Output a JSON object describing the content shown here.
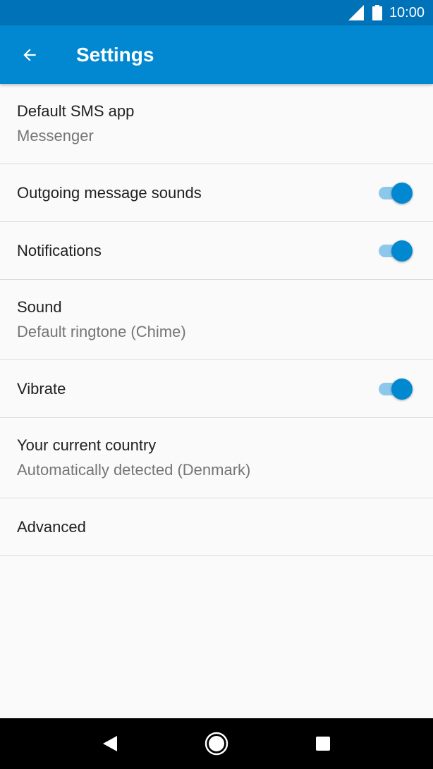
{
  "status_bar": {
    "time": "10:00",
    "icons": [
      "signal-icon",
      "battery-icon"
    ]
  },
  "app_bar": {
    "title": "Settings",
    "back_icon": "arrow-back-icon",
    "color": "#0288d1"
  },
  "settings": [
    {
      "label": "Default SMS app",
      "summary": "Messenger",
      "toggle": null
    },
    {
      "label": "Outgoing message sounds",
      "summary": null,
      "toggle": true
    },
    {
      "label": "Notifications",
      "summary": null,
      "toggle": true
    },
    {
      "label": "Sound",
      "summary": "Default ringtone (Chime)",
      "toggle": null
    },
    {
      "label": "Vibrate",
      "summary": null,
      "toggle": true
    },
    {
      "label": "Your current country",
      "summary": "Automatically detected (Denmark)",
      "toggle": null
    },
    {
      "label": "Advanced",
      "summary": null,
      "toggle": null
    }
  ],
  "nav_bar": {
    "buttons": [
      "nav-back-icon",
      "nav-home-icon",
      "nav-recents-icon"
    ]
  },
  "colors": {
    "status_bar": "#0072b8",
    "accent": "#0288d1",
    "switch_track": "#8cc8ec"
  }
}
